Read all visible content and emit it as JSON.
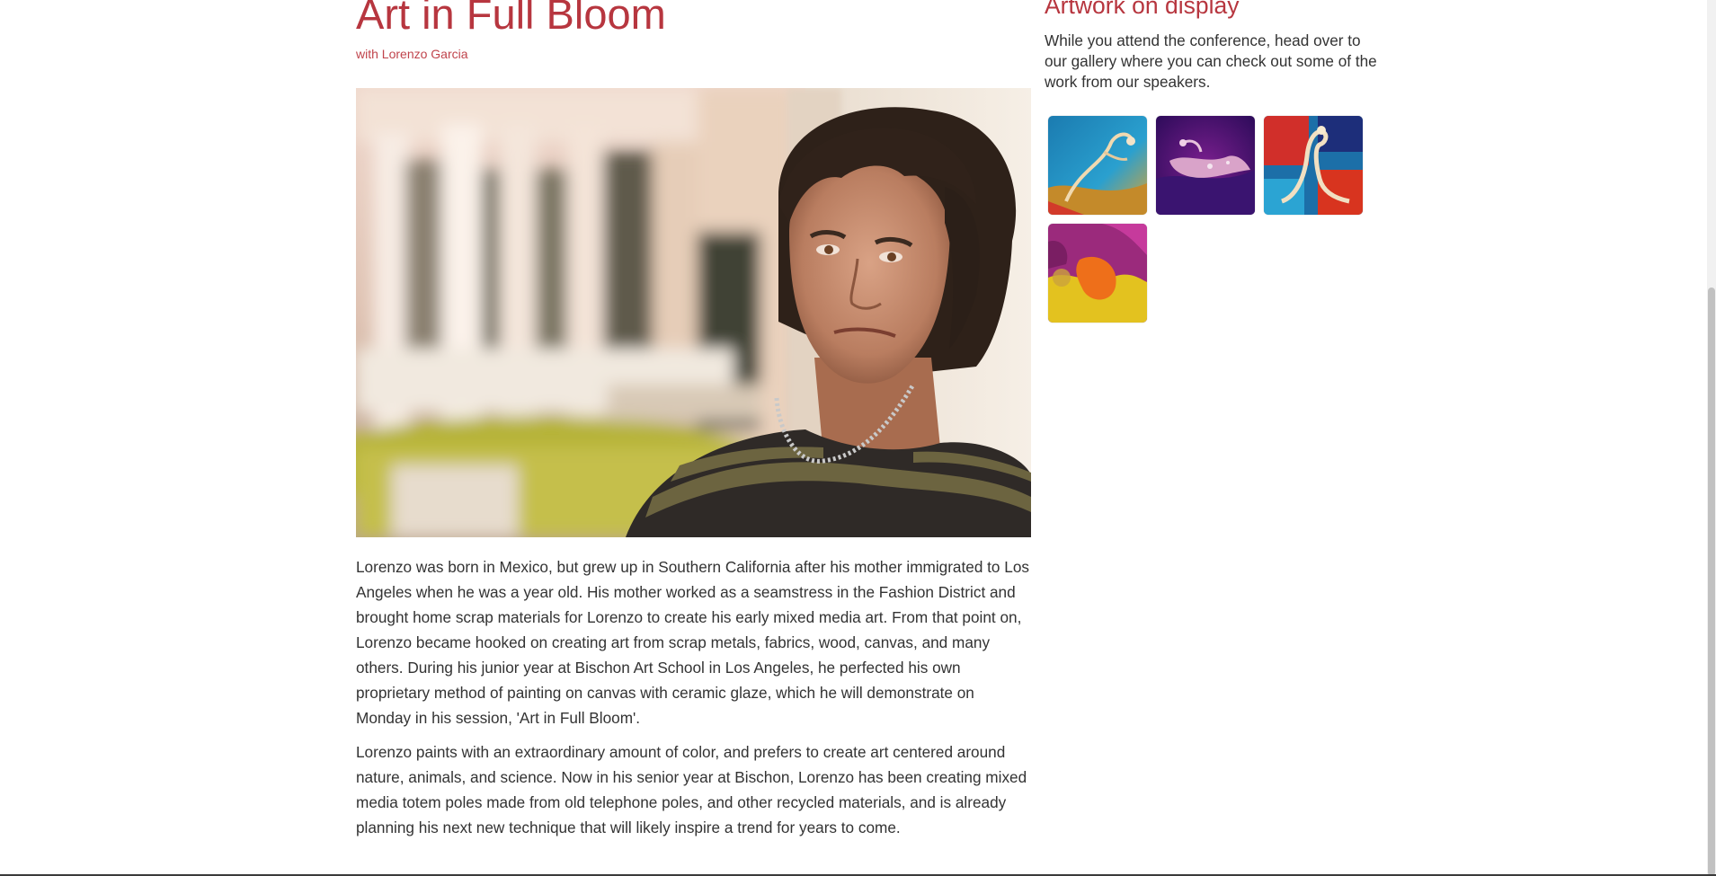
{
  "session": {
    "title": "Art in Full Bloom",
    "byline_prefix": "with",
    "speaker": "Lorenzo Garcia",
    "photo_alt": "Lorenzo Garcia"
  },
  "bio": {
    "paragraphs": [
      "Lorenzo was born in Mexico, but grew up in Southern California after his mother immigrated to Los Angeles when he was a year old. His mother worked as a seamstress in the Fashion District and brought home scrap materials for Lorenzo to create his early mixed media art. From that point on, Lorenzo became hooked on creating art from scrap metals, fabrics, wood, canvas, and many others. During his junior year at Bischon Art School in Los Angeles, he perfected his own proprietary method of painting on canvas with ceramic glaze, which he will demonstrate on Monday in his session, 'Art in Full Bloom'.",
      "Lorenzo paints with an extraordinary amount of color, and prefers to create art centered around nature, animals, and science. Now in his senior year at Bischon, Lorenzo has been creating mixed media totem poles made from old telephone poles, and other recycled materials, and is already planning his next new technique that will likely inspire a trend for years to come."
    ]
  },
  "sidebar": {
    "title": "Artwork on display",
    "text": "While you attend the conference, head over to our gallery where you can check out some of the work from our speakers."
  },
  "colors": {
    "accent": "#b7363f",
    "text": "#333333"
  }
}
